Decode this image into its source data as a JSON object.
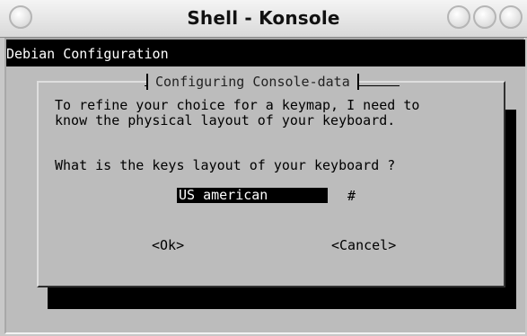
{
  "window": {
    "title": "Shell - Konsole"
  },
  "terminal": {
    "header": "Debian Configuration"
  },
  "dialog": {
    "title": "Configuring Console-data",
    "text_line_1": "To refine your choice for a keymap, I need to",
    "text_line_2": "know the physical layout of your keyboard.",
    "question": "What is the keys layout of your keyboard ?",
    "input_value": "US american",
    "input_marker": "#",
    "ok_label": "<Ok>",
    "cancel_label": "<Cancel>"
  },
  "colors": {
    "dialog_bg": "#bcbcbc",
    "terminal_header_bg": "#000000",
    "input_bg": "#000000",
    "input_fg": "#ffffff"
  }
}
